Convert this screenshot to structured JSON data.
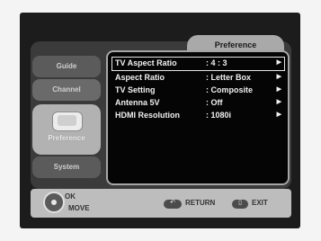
{
  "menu": {
    "title": "Preference",
    "tabs": [
      "Guide",
      "Channel",
      "Preference",
      "System"
    ],
    "items": [
      {
        "label": "TV Aspect Ratio",
        "value": ": 4 : 3"
      },
      {
        "label": "Aspect Ratio",
        "value": ": Letter Box"
      },
      {
        "label": "TV Setting",
        "value": ": Composite"
      },
      {
        "label": "Antenna 5V",
        "value": ": Off"
      },
      {
        "label": "HDMI Resolution",
        "value": ": 1080i"
      }
    ]
  },
  "bottom": {
    "ok": "OK",
    "move": "MOVE",
    "return": "RETURN",
    "exit": "EXIT"
  },
  "icons": {
    "nav_pad": "dpad-icon",
    "return": "return-icon",
    "exit": "exit-icon",
    "row_arrow": "arrow-right-icon"
  }
}
